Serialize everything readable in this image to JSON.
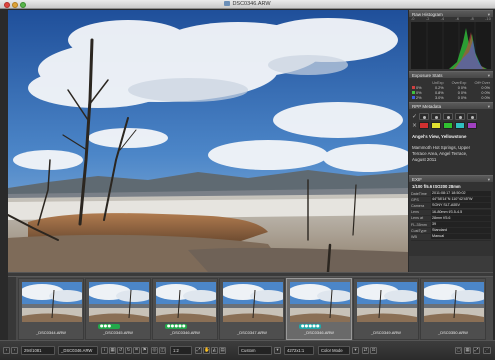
{
  "window": {
    "title": "DSC0346.ARW"
  },
  "panels": {
    "histogram": {
      "title": "Raw Histogram",
      "scale": [
        "-0",
        "-2",
        "-4",
        "-6",
        "-8",
        "-10"
      ]
    },
    "exposure": {
      "title": "Exposure Stats",
      "headers": [
        "",
        "UnExp",
        "OverExp",
        "Off+Over"
      ],
      "rows": [
        {
          "ch": "R",
          "color": "#d04040",
          "cols": [
            "0%",
            "0.2%",
            "0 0%",
            "0 0%"
          ]
        },
        {
          "ch": "G",
          "color": "#40c040",
          "cols": [
            "0%",
            "0.8%",
            "0 0%",
            "0 0%"
          ]
        },
        {
          "ch": "B",
          "color": "#4060e0",
          "cols": [
            "2%",
            "3.0%",
            "0 0%",
            "0 0%"
          ]
        }
      ]
    },
    "vk": {
      "title": "RPP Metadata",
      "colors": [
        "#d03030",
        "#e0e030",
        "#30c030",
        "#30c0c0",
        "#a040c0"
      ],
      "caption_title": "Angel's View, Yellowstone",
      "caption_lines": [
        "Mammoth Hot Springs, Upper",
        "Terrace Area, Angel Terrace,",
        "August 2011"
      ]
    },
    "info": {
      "title": "EXIF",
      "summary": "1/100 f/5.6 ISO200 28mm",
      "rows": [
        {
          "k": "DateTime",
          "v": "2011:08:17 18:50:02"
        },
        {
          "k": "GPS",
          "v": "44°58'14\"N 110°42'45\"W"
        },
        {
          "k": "Camera",
          "v": "SONY SLT-A55V"
        },
        {
          "k": "Lens",
          "v": "16-80mm f/3.5-4.5"
        },
        {
          "k": "Lens at",
          "v": "28mm f/5.6"
        },
        {
          "k": "FL-35mm",
          "v": "39"
        },
        {
          "k": "CustType",
          "v": "Standard"
        },
        {
          "k": "WB",
          "v": "Manual"
        }
      ]
    }
  },
  "filmstrip": {
    "thumbs": [
      {
        "name": "_DSC0344.ARW",
        "rating": "",
        "rating_color": "",
        "selected": false
      },
      {
        "name": "_DSC0345.ARW",
        "rating": "●●●",
        "rating_color": "#22a84a",
        "selected": false
      },
      {
        "name": "_DSC0346.ARW",
        "rating": "●●●●●",
        "rating_color": "#22a84a",
        "selected": false
      },
      {
        "name": "_DSC0347.ARW",
        "rating": "",
        "rating_color": "",
        "selected": false
      },
      {
        "name": "_DSC0346.ARW",
        "rating": "●●●●●",
        "rating_color": "#22a8a8",
        "selected": true
      },
      {
        "name": "_DSC0349.ARW",
        "rating": "",
        "rating_color": "",
        "selected": false
      },
      {
        "name": "_DSC0350.ARW",
        "rating": "",
        "rating_color": "",
        "selected": false
      }
    ]
  },
  "statusbar": {
    "counter": "294/1081",
    "file": "_DSC0346.ARW",
    "zoom": "1:2",
    "crop": "Custom",
    "size": "4272x1:1",
    "mode": "Color Mode"
  }
}
